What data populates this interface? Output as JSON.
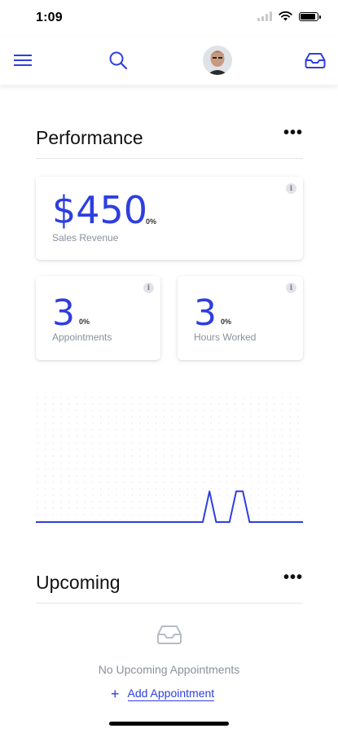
{
  "status_bar": {
    "time": "1:09"
  },
  "nav": {
    "menu_icon": "hamburger-icon",
    "search_icon": "search-icon",
    "inbox_icon": "inbox-icon"
  },
  "performance": {
    "title": "Performance",
    "more": "•••",
    "sales": {
      "value": "$450",
      "change": "0%",
      "label": "Sales Revenue"
    },
    "appointments": {
      "value": "3",
      "change": "0%",
      "label": "Appointments"
    },
    "hours": {
      "value": "3",
      "change": "0%",
      "label": "Hours Worked"
    },
    "info": "i"
  },
  "chart_data": {
    "type": "line",
    "x": [
      0,
      1,
      2,
      3,
      4,
      5,
      6,
      7,
      8,
      9,
      10,
      11,
      12,
      13,
      14,
      15,
      16,
      17,
      18,
      19,
      20,
      21,
      22,
      23,
      24,
      25,
      26,
      27,
      28,
      29,
      30,
      31,
      32,
      33,
      34,
      35,
      36,
      37,
      38,
      39,
      40
    ],
    "values": [
      0,
      0,
      0,
      0,
      0,
      0,
      0,
      0,
      0,
      0,
      0,
      0,
      0,
      0,
      0,
      0,
      0,
      0,
      0,
      0,
      0,
      0,
      0,
      0,
      0,
      0,
      1,
      0,
      0,
      0,
      1,
      1,
      0,
      0,
      0,
      0,
      0,
      0,
      0,
      0,
      0
    ],
    "ylim": [
      0,
      4
    ],
    "grid": "dotted",
    "color": "#2e3ee0"
  },
  "upcoming": {
    "title": "Upcoming",
    "more": "•••",
    "empty_icon": "inbox-icon",
    "empty_text": "No Upcoming Appointments",
    "add_plus": "+",
    "add_label": "Add Appointment"
  },
  "colors": {
    "accent": "#2e3ee0",
    "muted": "#8a909c",
    "divider": "#e3e5ea"
  }
}
